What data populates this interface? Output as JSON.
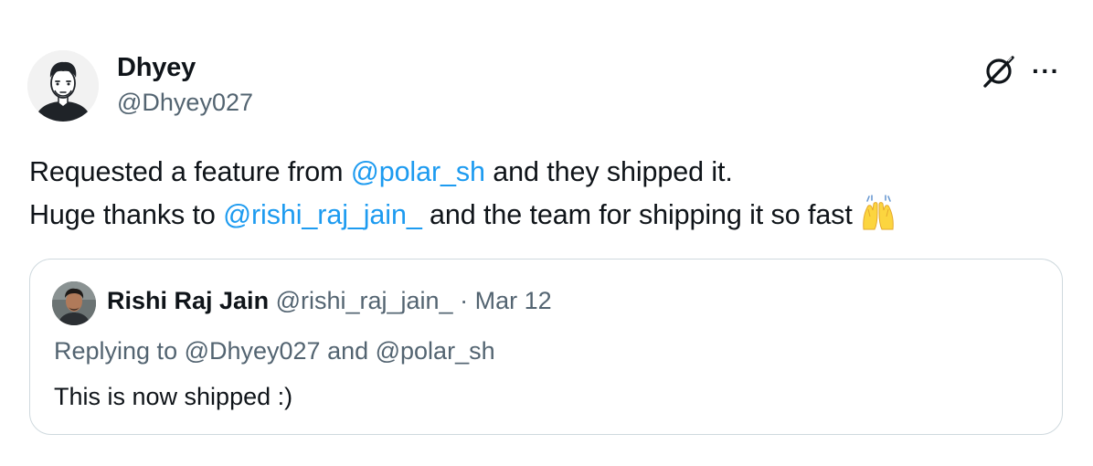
{
  "author": {
    "display_name": "Dhyey",
    "handle": "@Dhyey027"
  },
  "tweet": {
    "line1": {
      "before": "Requested a feature from ",
      "mention": "@polar_sh",
      "after": " and they shipped it."
    },
    "line2": {
      "before": " Huge thanks to ",
      "mention": "@rishi_raj_jain_",
      "after": " and the team for shipping it so fast "
    },
    "emoji": "raising-hands-emoji"
  },
  "actions": {
    "grok_icon": "grok-icon",
    "more_label": "···"
  },
  "quoted_tweet": {
    "display_name": "Rishi Raj Jain",
    "handle": "@rishi_raj_jain_",
    "separator": " · ",
    "date": "Mar 12",
    "replying_to": "Replying to @Dhyey027 and @polar_sh",
    "text": "This is now shipped :)"
  },
  "colors": {
    "mention": "#1d9bf0",
    "secondary_text": "#536471",
    "border": "#cfd9de"
  }
}
